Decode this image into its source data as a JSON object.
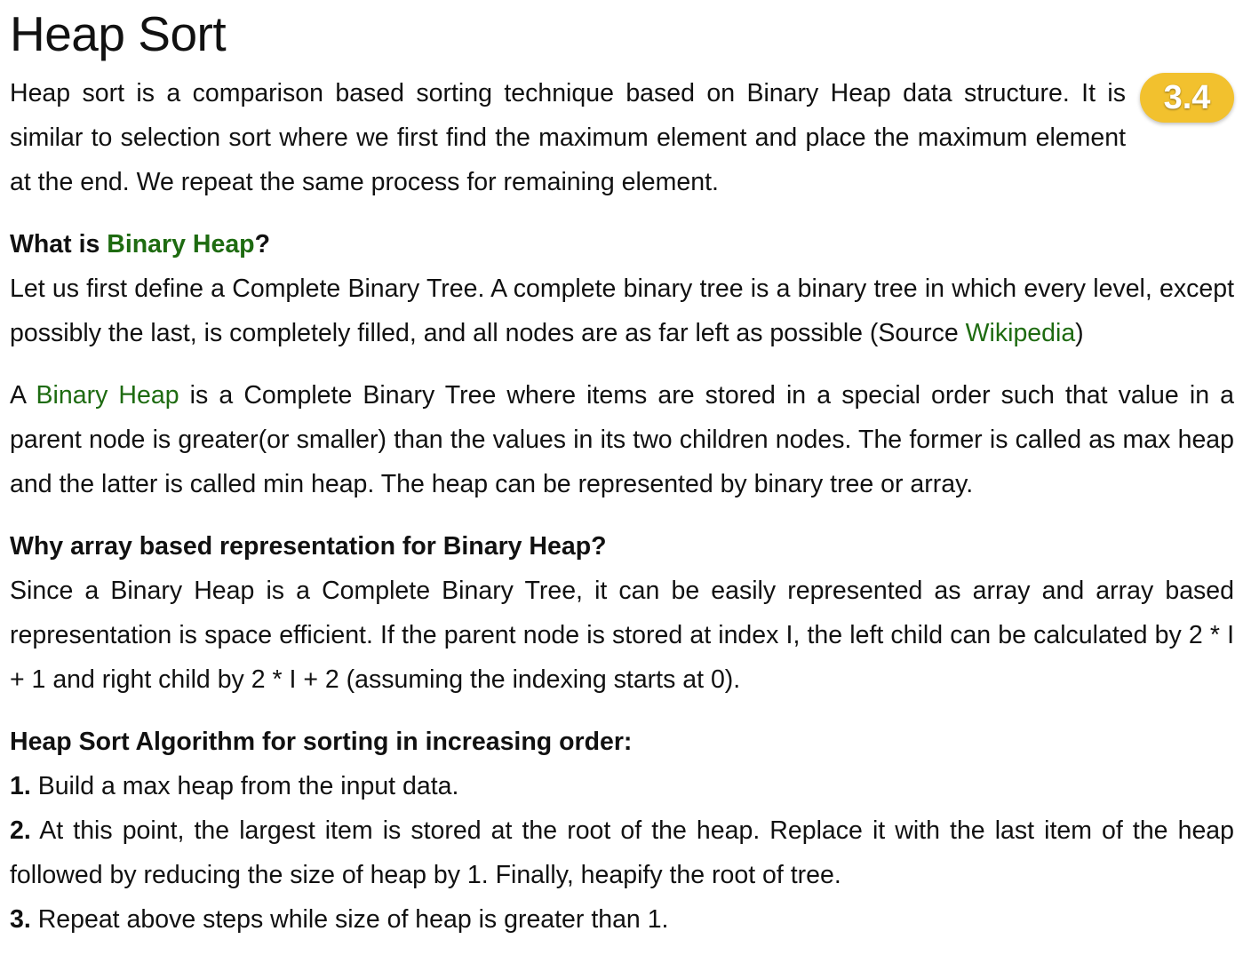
{
  "title": "Heap Sort",
  "badge": "3.4",
  "intro": "Heap sort is a comparison based sorting technique based on Binary Heap data structure. It is similar to selection sort where we first find the maximum element and place the maximum ele­ment at the end. We repeat the same process for remaining element.",
  "section1": {
    "heading_prefix": "What is ",
    "heading_link": "Binary Heap",
    "heading_suffix": "?",
    "para_text": "Let us first define a Complete Binary Tree. A complete binary tree is a binary tree in which every level, except possibly the last, is completely filled, and all nodes are as far left as possible (Source ",
    "para_link": "Wikipedia",
    "para_end": ")"
  },
  "section2": {
    "prefix": "A ",
    "link": "Binary Heap",
    "text": " is a Complete Binary Tree where items are stored in a special order such that value in a parent node is greater(or smaller) than the values in its two children nodes. The former is called as max heap and the latter is called min heap. The heap can be represented by binary tree or array."
  },
  "section3": {
    "heading": "Why array based representation for Binary Heap?",
    "text": "Since a Binary Heap is a Complete Binary Tree, it can be easily represented as array and array based representation is space efficient. If the parent node is stored at index I, the left child can be calculated by 2 * I + 1 and right child by 2 * I + 2 (assuming the indexing starts at 0)."
  },
  "section4": {
    "heading": "Heap Sort Algorithm for sorting in increasing order:",
    "steps": [
      {
        "num": "1.",
        "text": " Build a max heap from the input data."
      },
      {
        "num": "2.",
        "text": " At this point, the largest item is stored at the root of the heap. Replace it with the last item of the heap followed by reducing the size of heap by 1. Finally, heapify the root of tree."
      },
      {
        "num": "3.",
        "text": " Repeat above steps while size of heap is greater than 1."
      }
    ]
  }
}
